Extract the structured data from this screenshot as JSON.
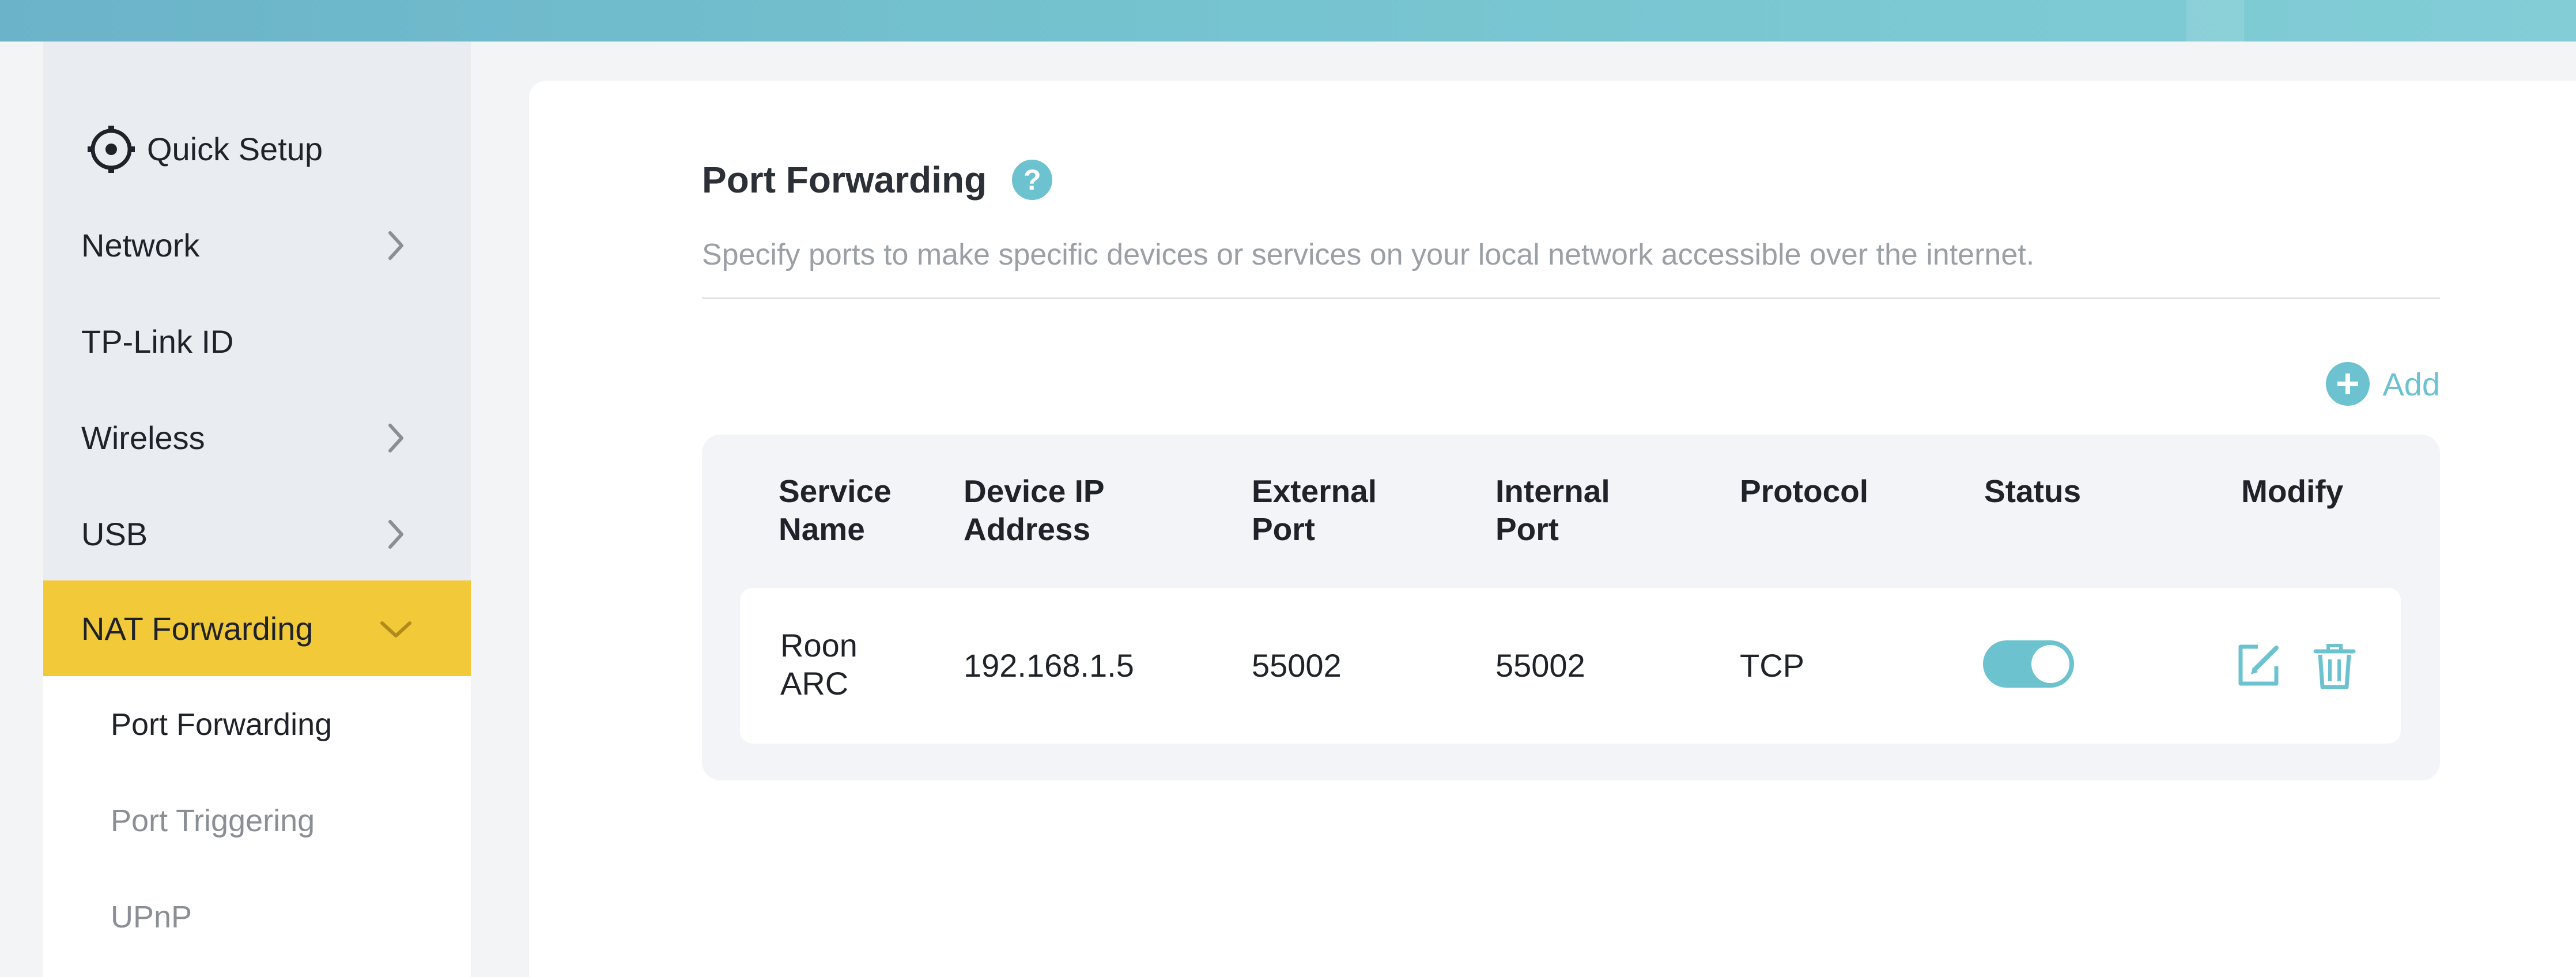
{
  "sidebar": {
    "items": [
      {
        "label": "Quick Setup",
        "icon": "quick-setup-icon"
      },
      {
        "label": "Network",
        "icon": "chevron-right-icon"
      },
      {
        "label": "TP-Link ID"
      },
      {
        "label": "Wireless",
        "icon": "chevron-right-icon"
      },
      {
        "label": "USB",
        "icon": "chevron-right-icon"
      },
      {
        "label": "NAT Forwarding",
        "icon": "chevron-down-icon",
        "active": true
      }
    ],
    "submenu": [
      {
        "label": "Port Forwarding",
        "current": true
      },
      {
        "label": "Port Triggering"
      },
      {
        "label": "UPnP"
      }
    ]
  },
  "main": {
    "title": "Port Forwarding",
    "help_icon": "question-mark-icon",
    "description": "Specify ports to make specific devices or services on your local network accessible over the internet.",
    "add_label": "Add"
  },
  "table": {
    "headers": [
      "Service\nName",
      "Device IP\nAddress",
      "External\nPort",
      "Internal\nPort",
      "Protocol",
      "Status",
      "Modify"
    ],
    "rows": [
      {
        "service_name": "Roon\nARC",
        "device_ip": "192.168.1.5",
        "external_port": "55002",
        "internal_port": "55002",
        "protocol": "TCP",
        "status_on": true,
        "actions": [
          "edit-icon",
          "trash-icon"
        ]
      }
    ]
  },
  "colors": {
    "accent": "#6cc3cf",
    "active_nav": "#f2c938",
    "topbar": "#75c3cf"
  }
}
